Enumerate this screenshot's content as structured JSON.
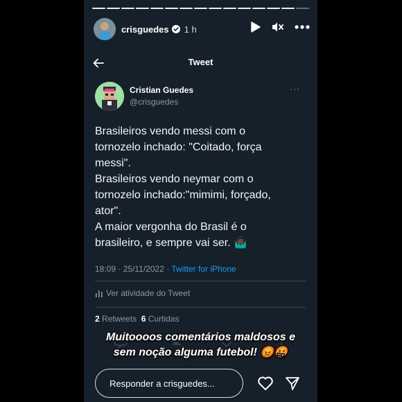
{
  "story": {
    "progress_segments": 15,
    "username": "crisguedes",
    "time": "1 h",
    "icons": [
      "play-icon",
      "mute-icon",
      "more-icon"
    ]
  },
  "tweet": {
    "header_title": "Tweet",
    "author_name": "Cristian Guedes",
    "author_handle": "@crisguedes",
    "more": "···",
    "lines": [
      "Brasileiros vendo messi com o",
      "tornozelo inchado: \"Coitado, força",
      "messi\".",
      "Brasileiros vendo neymar com o",
      "tornozelo inchado:\"mimimi, forçado,",
      "ator\".",
      "A maior vergonha do Brasil é o",
      "brasileiro, e sempre vai ser. 🤷🏿‍♂️"
    ],
    "timestamp": "18:09 · 25/11/2022 · ",
    "source": "Twitter for iPhone",
    "activity_label": "Ver atividade do Tweet",
    "retweets_count": "2",
    "retweets_label": "Retweets",
    "likes_count": "6",
    "likes_label": "Curtidas"
  },
  "caption": {
    "line1": "Muitoooos comentários maldosos e",
    "line2": "sem noção alguma futebol! 😡🤬"
  },
  "reply": {
    "placeholder": "Responder a crisguedes..."
  },
  "colors": {
    "background": "#15202b",
    "link": "#1d9bf0",
    "muted": "#8b98a5",
    "verified": "#1d9bf0"
  }
}
